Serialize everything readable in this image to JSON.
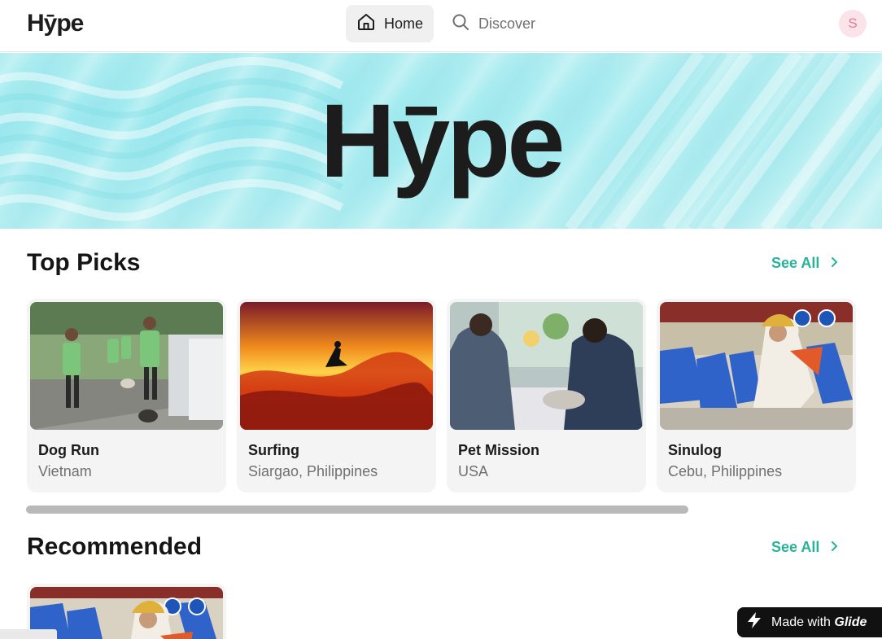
{
  "app": {
    "logo": "Hȳpe",
    "avatar_initial": "S",
    "accent": "#27b39a"
  },
  "nav": {
    "items": [
      {
        "label": "Home",
        "icon": "home-icon"
      },
      {
        "label": "Discover",
        "icon": "search-icon"
      }
    ]
  },
  "hero": {
    "title": "Hȳpe"
  },
  "top_picks": {
    "title": "Top Picks",
    "see_all": "See All",
    "cards": [
      {
        "title": "Dog Run",
        "subtitle": "Vietnam"
      },
      {
        "title": "Surfing",
        "subtitle": "Siargao, Philippines"
      },
      {
        "title": "Pet Mission",
        "subtitle": "USA"
      },
      {
        "title": "Sinulog",
        "subtitle": "Cebu, Philippines"
      }
    ]
  },
  "recommended": {
    "title": "Recommended",
    "see_all": "See All"
  },
  "badge": {
    "prefix": "Made with",
    "brand": "Glide"
  }
}
